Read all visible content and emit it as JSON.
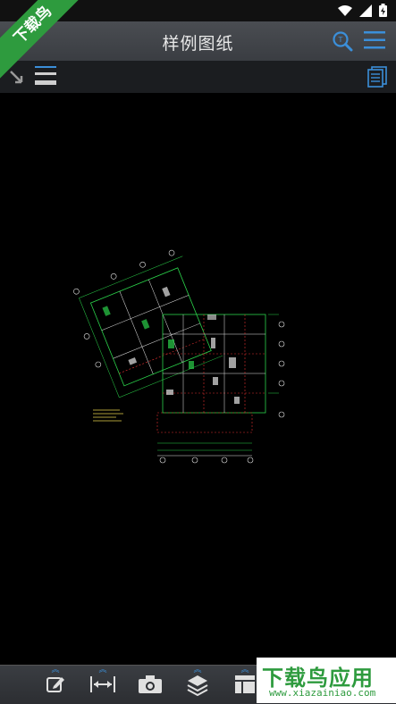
{
  "app": {
    "title": "样例图纸"
  },
  "watermark": {
    "top_left": "下载鸟",
    "bottom_right_title": "下载鸟应用",
    "bottom_right_url": "www.xiazainiao.com"
  },
  "colors": {
    "accent": "#3b8fd9",
    "cad_green": "#2bd24a",
    "cad_red": "#e23030",
    "cad_white": "#e6e6e6",
    "cad_yellow": "#e6d24a"
  },
  "icons": {
    "status": [
      "wifi-icon",
      "signal-icon",
      "battery-icon"
    ],
    "appbar": [
      "search-icon",
      "menu-icon"
    ],
    "toolbar": [
      "collapse-arrow-icon",
      "layer-lines-icon",
      "pages-icon"
    ],
    "bottom": [
      "annotate-icon",
      "measure-icon",
      "camera-icon",
      "layers-icon",
      "layout-icon"
    ]
  }
}
